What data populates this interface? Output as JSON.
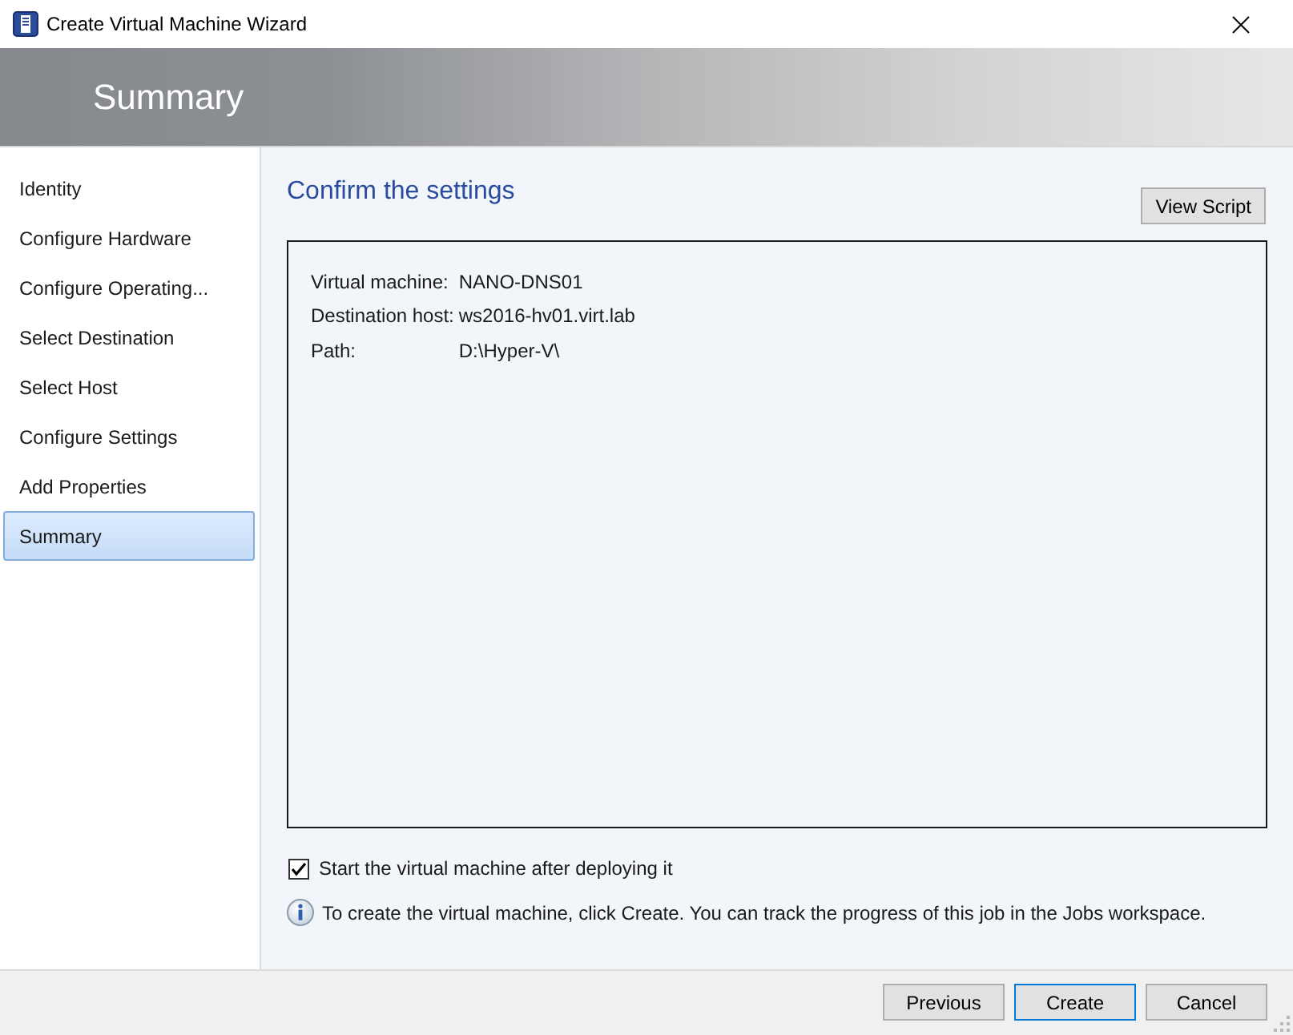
{
  "window": {
    "title": "Create Virtual Machine Wizard"
  },
  "header": {
    "title": "Summary"
  },
  "steps": [
    {
      "label": "Identity",
      "selected": false
    },
    {
      "label": "Configure Hardware",
      "selected": false
    },
    {
      "label": "Configure Operating...",
      "selected": false
    },
    {
      "label": "Select Destination",
      "selected": false
    },
    {
      "label": "Select Host",
      "selected": false
    },
    {
      "label": "Configure Settings",
      "selected": false
    },
    {
      "label": "Add Properties",
      "selected": false
    },
    {
      "label": "Summary",
      "selected": true
    }
  ],
  "content": {
    "heading": "Confirm the settings",
    "view_script_button": "View Script",
    "summary": [
      {
        "label": "Virtual machine:",
        "value": "NANO-DNS01"
      },
      {
        "label": "Destination host:",
        "value": "ws2016-hv01.virt.lab"
      },
      {
        "label": "Path:",
        "value": "D:\\Hyper-V\\"
      }
    ],
    "start_after_deploy": {
      "label": "Start the virtual machine after deploying it",
      "checked": true
    },
    "info": "To create the virtual machine, click Create. You can track the progress of this job in the Jobs workspace."
  },
  "buttons": [
    {
      "label": "Previous",
      "default": false
    },
    {
      "label": "Create",
      "default": true
    },
    {
      "label": "Cancel",
      "default": false
    }
  ]
}
